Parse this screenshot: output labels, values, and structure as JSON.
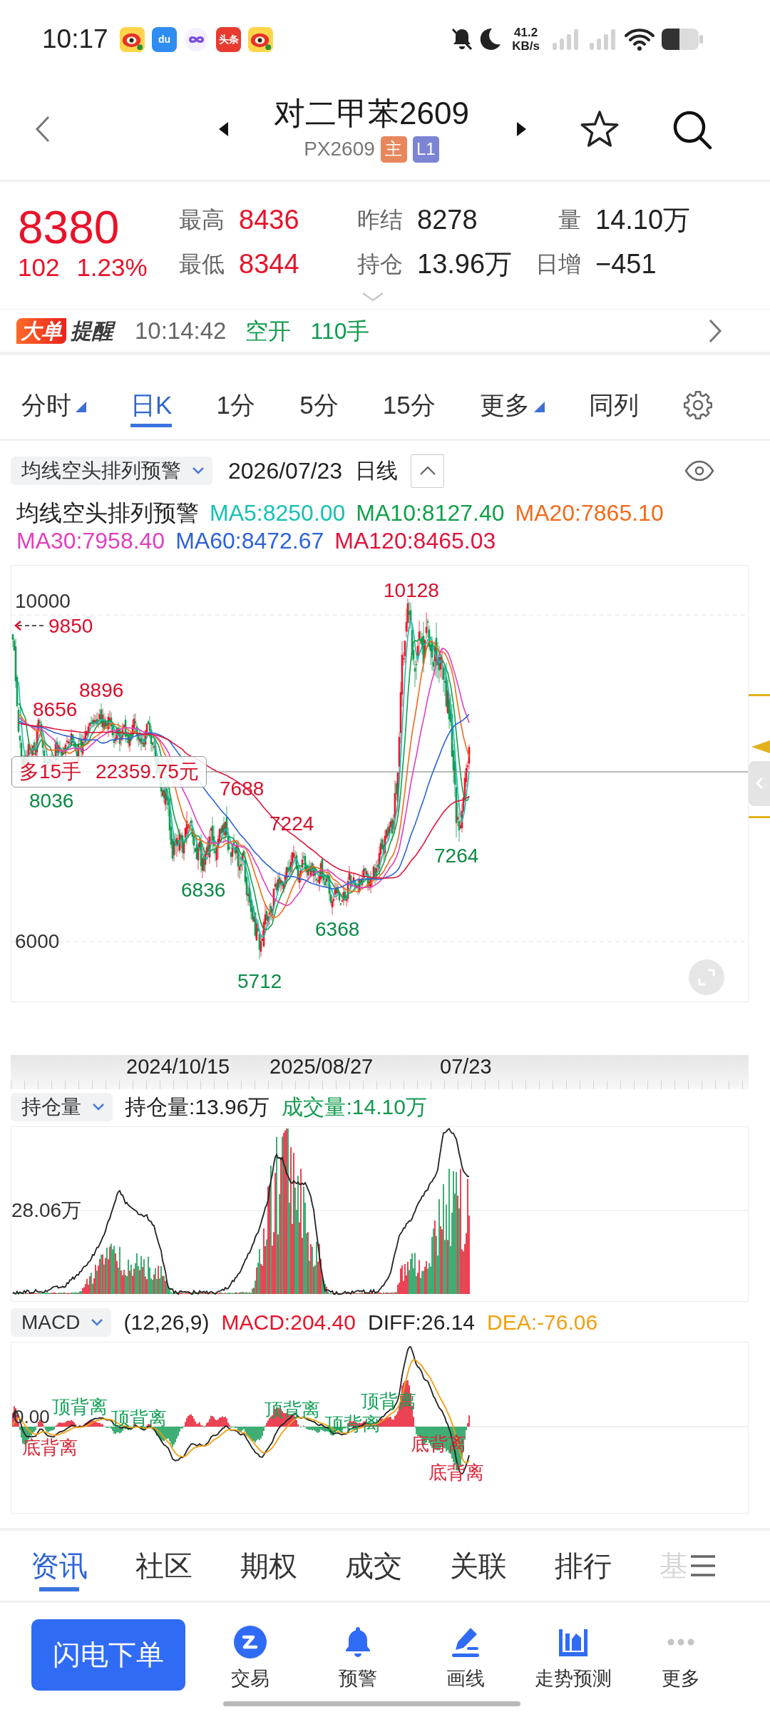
{
  "status_bar": {
    "time": "10:17",
    "app_icons": [
      {
        "kind": "eye"
      },
      {
        "kind": "text",
        "text": "du",
        "color": "#2f8cf0"
      },
      {
        "kind": "loop"
      },
      {
        "kind": "text",
        "text": "头条",
        "color": "#e63b2e"
      },
      {
        "kind": "eye"
      }
    ],
    "net_speed": "41.2",
    "net_speed_unit": "KB/s"
  },
  "header": {
    "title": "对二甲苯2609",
    "code": "PX2609",
    "badges": [
      {
        "text": "主",
        "color": "#e8875c"
      },
      {
        "text": "L1",
        "color": "#7c84d4"
      }
    ]
  },
  "quote": {
    "price": "8380",
    "change": "102",
    "change_percent": "1.23%",
    "stats": [
      {
        "label": "最高",
        "value": "8436",
        "color": "#e8132a"
      },
      {
        "label": "昨结",
        "value": "8278",
        "color": "#222222"
      },
      {
        "label": "量",
        "value": "14.10万",
        "color": "#222222"
      },
      {
        "label": "最低",
        "value": "8344",
        "color": "#e8132a"
      },
      {
        "label": "持仓",
        "value": "13.96万",
        "color": "#222222"
      },
      {
        "label": "日增",
        "value": "−451",
        "color": "#222222"
      }
    ]
  },
  "big_order_alert": {
    "badge": "大单",
    "title": "提醒",
    "time": "10:14:42",
    "action": "空开",
    "volume": "110手"
  },
  "period_tabs": [
    {
      "label": "分时",
      "selected": false,
      "has_menu": true
    },
    {
      "label": "日K",
      "selected": true,
      "has_menu": false
    },
    {
      "label": "1分",
      "selected": false,
      "has_menu": false
    },
    {
      "label": "5分",
      "selected": false,
      "has_menu": false
    },
    {
      "label": "15分",
      "selected": false,
      "has_menu": false
    },
    {
      "label": "更多",
      "selected": false,
      "has_menu": true
    },
    {
      "label": "同列",
      "selected": false,
      "has_menu": false
    }
  ],
  "indicator_bar": {
    "dropdown": "均线空头排列预警",
    "date": "2026/07/23",
    "period": "日线"
  },
  "ma_legend": {
    "title": "均线空头排列预警",
    "items": [
      {
        "label": "MA5:8250.00",
        "color": "#16c1b2"
      },
      {
        "label": "MA10:8127.40",
        "color": "#12a04a"
      },
      {
        "label": "MA20:7865.10",
        "color": "#f26a1b"
      },
      {
        "label": "MA30:7958.40",
        "color": "#e03fbd"
      },
      {
        "label": "MA60:8472.67",
        "color": "#2d63d8"
      },
      {
        "label": "MA120:8465.03",
        "color": "#e0143c"
      }
    ]
  },
  "price_chart": {
    "y_labels": [
      "10000",
      "6000"
    ],
    "offscreen_high": "9850",
    "annotations": [
      {
        "text": "10128",
        "kind": "high"
      },
      {
        "text": "8896",
        "kind": "high"
      },
      {
        "text": "8656",
        "kind": "high"
      },
      {
        "text": "8036",
        "kind": "low"
      },
      {
        "text": "7688",
        "kind": "high"
      },
      {
        "text": "7224",
        "kind": "high"
      },
      {
        "text": "7264",
        "kind": "low"
      },
      {
        "text": "6836",
        "kind": "low"
      },
      {
        "text": "6368",
        "kind": "low"
      },
      {
        "text": "5712",
        "kind": "low"
      }
    ],
    "position_tag": "多15手 22359.75元"
  },
  "date_axis": [
    "2024/10/15",
    "2025/08/27",
    "07/23"
  ],
  "volume_panel": {
    "dropdown": "持仓量",
    "open_interest": "持仓量:13.96万",
    "volume": "成交量:14.10万",
    "y_label": "28.06万"
  },
  "macd_panel": {
    "dropdown": "MACD",
    "params": "(12,26,9)",
    "values": [
      {
        "text": "MACD:204.40",
        "color": "#e8132a"
      },
      {
        "text": "DIFF:26.14",
        "color": "#222222"
      },
      {
        "text": "DEA:-76.06",
        "color": "#f0a012"
      }
    ],
    "zero_label": "0.00",
    "signals": [
      {
        "text": "底背离",
        "kind": "bottom"
      },
      {
        "text": "顶背离",
        "kind": "top"
      },
      {
        "text": "顶背离",
        "kind": "top"
      },
      {
        "text": "顶背离",
        "kind": "top"
      },
      {
        "text": "顶背离",
        "kind": "top"
      },
      {
        "text": "顶背离",
        "kind": "top"
      },
      {
        "text": "底背离",
        "kind": "bottom"
      },
      {
        "text": "底背离",
        "kind": "bottom"
      }
    ]
  },
  "bottom_tabs": [
    {
      "label": "资讯",
      "selected": true,
      "faded": false
    },
    {
      "label": "社区",
      "selected": false,
      "faded": false
    },
    {
      "label": "期权",
      "selected": false,
      "faded": false
    },
    {
      "label": "成交",
      "selected": false,
      "faded": false
    },
    {
      "label": "关联",
      "selected": false,
      "faded": false
    },
    {
      "label": "排行",
      "selected": false,
      "faded": false
    },
    {
      "label": "基",
      "selected": false,
      "faded": true
    }
  ],
  "toolbar": {
    "primary": "闪电下单",
    "items": [
      {
        "label": "交易",
        "kind": "trade"
      },
      {
        "label": "预警",
        "kind": "alert"
      },
      {
        "label": "画线",
        "kind": "draw"
      },
      {
        "label": "走势预测",
        "kind": "forecast"
      },
      {
        "label": "更多",
        "kind": "more"
      }
    ]
  }
}
